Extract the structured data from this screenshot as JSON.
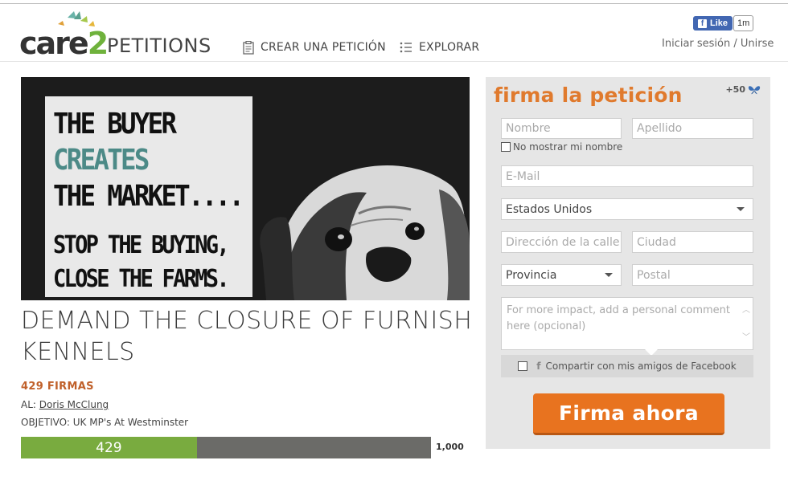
{
  "header": {
    "logo_care": "care",
    "logo_two": "2",
    "logo_petitions": "PETITIONS",
    "nav": [
      {
        "label": "CREAR UNA PETICIÓN",
        "icon": "clipboard-icon"
      },
      {
        "label": "EXPLORAR",
        "icon": "list-icon"
      }
    ],
    "fb_like_label": "Like",
    "fb_like_count": "1m",
    "login_label": "Iniciar sesión",
    "separator": "/",
    "join_label": "Unirse"
  },
  "petition": {
    "image_text": {
      "line1": "THE BUYER",
      "line2": "CREATES",
      "line3": "THE MARKET....",
      "line4": "STOP THE BUYING,",
      "line5": "CLOSE THE FARMS."
    },
    "title": "DEMAND THE CLOSURE OF FURNISH KENNELS",
    "signatures_label": "429 FIRMAS",
    "to_prefix": "AL:",
    "to_name": "Doris McClung",
    "objective_label": "OBJETIVO: UK MP's At Westminster",
    "progress": {
      "current": 429,
      "goal": 1000,
      "current_label": "429",
      "goal_label": "1,000"
    }
  },
  "sign_form": {
    "title": "firma la petición",
    "points": "+50",
    "first_name_placeholder": "Nombre",
    "last_name_placeholder": "Apellido",
    "hide_name_label": "No mostrar mi nombre",
    "email_placeholder": "E-Mail",
    "country_value": "Estados Unidos",
    "street_placeholder": "Dirección de la calle",
    "city_placeholder": "Ciudad",
    "province_value": "Provincia",
    "postal_placeholder": "Postal",
    "comment_placeholder": "For more impact, add a personal comment here (opcional)",
    "share_facebook_label": "Compartir con mis amigos de Facebook",
    "submit_label": "Firma ahora"
  },
  "colors": {
    "accent_orange": "#e8731f",
    "brand_green": "#6fb23c",
    "progress_green": "#79ab3f",
    "facebook_blue": "#4267b2"
  }
}
